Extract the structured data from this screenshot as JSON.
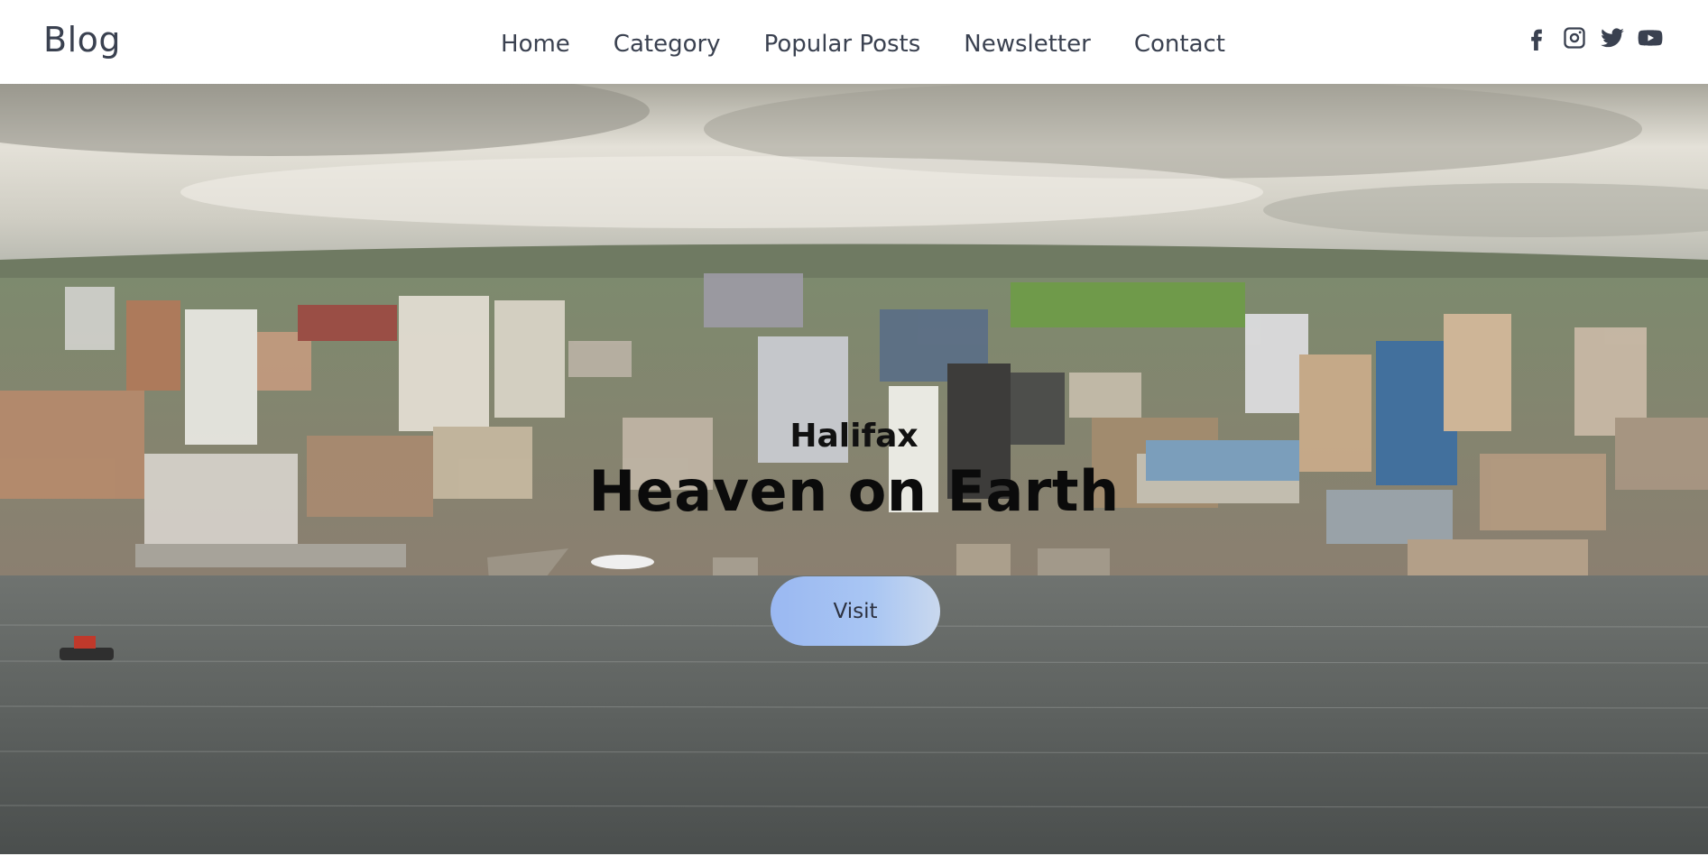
{
  "navbar": {
    "brand": "Blog",
    "links": [
      {
        "label": "Home"
      },
      {
        "label": "Category"
      },
      {
        "label": "Popular Posts"
      },
      {
        "label": "Newsletter"
      },
      {
        "label": "Contact"
      }
    ],
    "social_icons": [
      "facebook-icon",
      "instagram-icon",
      "twitter-icon",
      "youtube-icon"
    ]
  },
  "hero": {
    "subtitle": "Halifax",
    "title": "Heaven on Earth",
    "button_label": "Visit",
    "colors": {
      "button_gradient_start": "#9ab8f2",
      "button_gradient_end": "#c9d8ee",
      "title_text": "#0b0b0b"
    }
  }
}
